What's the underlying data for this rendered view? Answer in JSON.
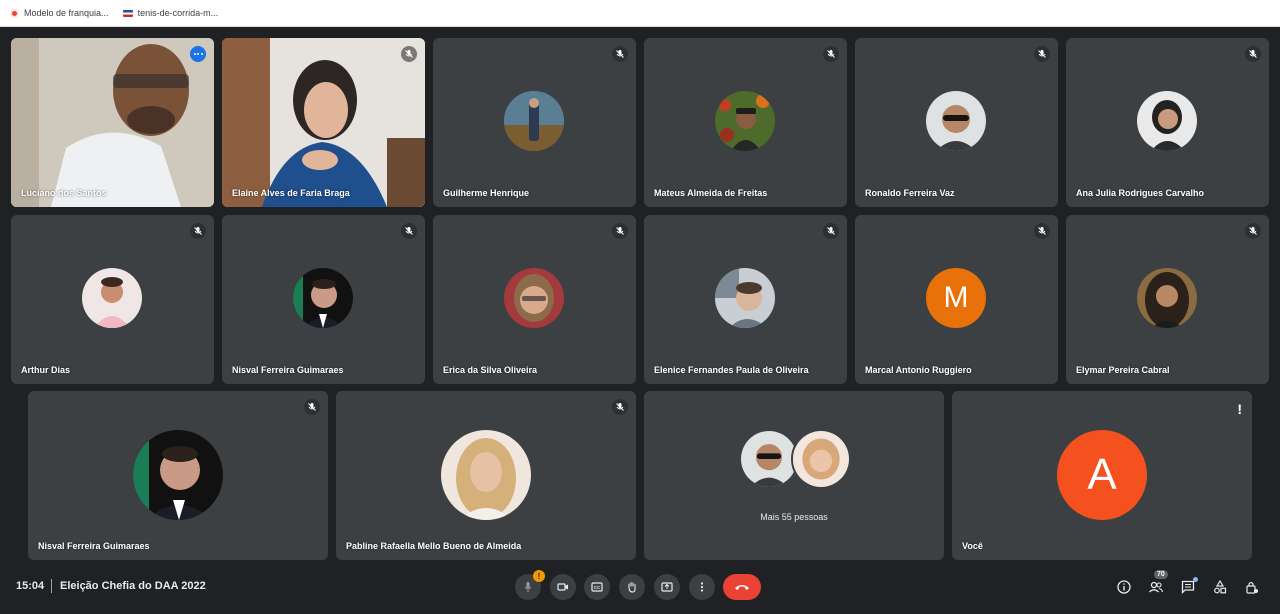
{
  "bookmarks": [
    {
      "label": "Modelo de franquia..."
    },
    {
      "label": "tenis-de-corrida-m..."
    }
  ],
  "participants": [
    {
      "name": "Luciano dos Santos"
    },
    {
      "name": "Elaine Alves de Faria Braga"
    },
    {
      "name": "Guilherme Henrique"
    },
    {
      "name": "Mateus Almeida de Freitas"
    },
    {
      "name": "Ronaldo Ferreira Vaz"
    },
    {
      "name": "Ana Julia Rodrigues Carvalho"
    },
    {
      "name": "Arthur Dias"
    },
    {
      "name": "Nisval Ferreira Guimaraes"
    },
    {
      "name": "Erica da Silva Oliveira"
    },
    {
      "name": "Elenice Fernandes Paula de Oliveira"
    },
    {
      "name": "Marcal Antonio Ruggiero",
      "initial": "M",
      "color": "#e8710a"
    },
    {
      "name": "Elymar Pereira Cabral"
    },
    {
      "name": "Nisval Ferreira Guimaraes"
    },
    {
      "name": "Pabline Rafaella Mello Bueno de Almeida"
    },
    {
      "more_label": "Mais 55 pessoas"
    },
    {
      "name": "Você",
      "initial": "A",
      "color": "#f4511e"
    }
  ],
  "bottom_bar": {
    "time": "15:04",
    "meeting_title": "Eleição Chefia do DAA 2022",
    "mic_badge": "!",
    "people_count": "70",
    "controls": [
      "mic-icon",
      "camera-icon",
      "captions-icon",
      "raise-hand-icon",
      "present-icon",
      "more-options-icon",
      "hang-up-icon"
    ],
    "right_icons": [
      "info-icon",
      "people-icon",
      "chat-icon",
      "activities-icon",
      "host-controls-icon"
    ]
  },
  "colors": {
    "background": "#202124",
    "tile": "#3c4043",
    "accent": "#8ab4f8",
    "hangup": "#ea4335"
  }
}
